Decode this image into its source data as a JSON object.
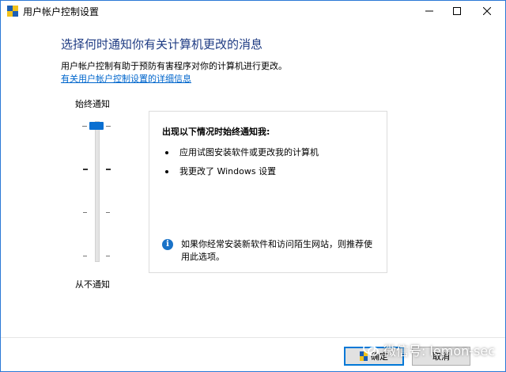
{
  "window": {
    "title": "用户帐户控制设置",
    "controls": {
      "minimize": "—",
      "maximize": "☐",
      "close": "✕"
    }
  },
  "main": {
    "heading": "选择何时通知你有关计算机更改的消息",
    "description": "用户帐户控制有助于预防有害程序对你的计算机进行更改。",
    "link": "有关用户帐户控制设置的详细信息"
  },
  "slider": {
    "top_label": "始终通知",
    "bottom_label": "从不通知",
    "levels": 4,
    "selected_level": 4
  },
  "info_panel": {
    "title": "出现以下情况时始终通知我:",
    "bullets": [
      "应用试图安装软件或更改我的计算机",
      "我更改了 Windows 设置"
    ],
    "note": "如果你经常安装新软件和访问陌生网站，则推荐使用此选项。"
  },
  "footer": {
    "ok_label": "确定",
    "cancel_label": "取消"
  },
  "watermark": {
    "text": "微信号: lemon-sec"
  },
  "colors": {
    "heading": "#1e3b83",
    "link": "#0066cc",
    "slider_thumb": "#0a6fd1",
    "window_border": "#2b78d6",
    "info_icon": "#1a73c8"
  }
}
